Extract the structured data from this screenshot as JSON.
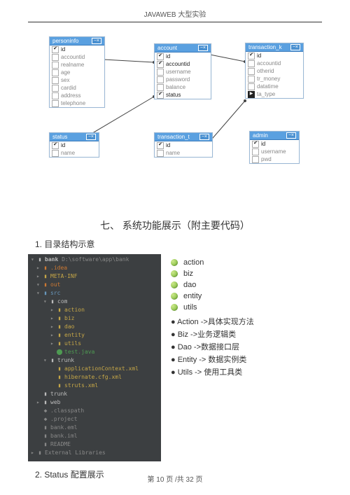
{
  "header": "JAVAWEB 大型实验",
  "er": {
    "tables": {
      "personinfo": {
        "title": "personinfo",
        "fields": [
          {
            "name": "id",
            "checked": true
          },
          {
            "name": "accountid"
          },
          {
            "name": "realname"
          },
          {
            "name": "age"
          },
          {
            "name": "sex"
          },
          {
            "name": "cardid"
          },
          {
            "name": "address"
          },
          {
            "name": "telephone"
          }
        ]
      },
      "status": {
        "title": "status",
        "fields": [
          {
            "name": "id",
            "checked": true
          },
          {
            "name": "name"
          }
        ]
      },
      "account": {
        "title": "account",
        "fields": [
          {
            "name": "id",
            "checked": true
          },
          {
            "name": "accountid",
            "checked": true
          },
          {
            "name": "username"
          },
          {
            "name": "password"
          },
          {
            "name": "balance"
          },
          {
            "name": "status",
            "checked": true
          }
        ]
      },
      "transaction_t": {
        "title": "transaction_t",
        "fields": [
          {
            "name": "id",
            "checked": true
          },
          {
            "name": "name"
          }
        ]
      },
      "transaction_k": {
        "title": "transaction_k",
        "fields": [
          {
            "name": "id",
            "checked": true
          },
          {
            "name": "accountid"
          },
          {
            "name": "otherid"
          },
          {
            "name": "tr_money"
          },
          {
            "name": "datatime"
          },
          {
            "name": "ta_type",
            "dark": true
          }
        ]
      },
      "admin": {
        "title": "admin",
        "fields": [
          {
            "name": "id",
            "checked": true
          },
          {
            "name": "username"
          },
          {
            "name": "pwd"
          }
        ]
      }
    }
  },
  "section7": "七、  系统功能展示（附主要代码）",
  "subsection1": "1. 目录结构示意",
  "tree": {
    "root": "bank",
    "rootpath": "D:\\software\\app\\bank"
  },
  "tree_nodes": [
    {
      "cls": "ind1 orange",
      "arrow": "▸",
      "icon": "▮",
      "text": ".idea"
    },
    {
      "cls": "ind1 yellow",
      "arrow": "▸",
      "icon": "▮",
      "text": "META-INF"
    },
    {
      "cls": "ind1 orange",
      "arrow": "▾",
      "icon": "▮",
      "text": "out"
    },
    {
      "cls": "ind1 blue",
      "arrow": "▾",
      "icon": "▮",
      "text": "src"
    },
    {
      "cls": "ind2",
      "arrow": "▾",
      "icon": "▮",
      "text": "com"
    },
    {
      "cls": "ind3 yellow",
      "arrow": "▸",
      "icon": "▮",
      "text": "action"
    },
    {
      "cls": "ind3 yellow",
      "arrow": "▸",
      "icon": "▮",
      "text": "biz"
    },
    {
      "cls": "ind3 yellow",
      "arrow": "▸",
      "icon": "▮",
      "text": "dao"
    },
    {
      "cls": "ind3 yellow",
      "arrow": "▸",
      "icon": "▮",
      "text": "entity"
    },
    {
      "cls": "ind3 yellow",
      "arrow": "▸",
      "icon": "▮",
      "text": "utils"
    },
    {
      "cls": "ind3 green",
      "arrow": " ",
      "icon": "⬤",
      "text": "test.java"
    },
    {
      "cls": "ind2",
      "arrow": "▾",
      "icon": "▮",
      "text": "trunk"
    },
    {
      "cls": "ind3 yellow",
      "arrow": " ",
      "icon": "▮",
      "text": "applicationContext.xml"
    },
    {
      "cls": "ind3 yellow",
      "arrow": " ",
      "icon": "▮",
      "text": "hibernate.cfg.xml"
    },
    {
      "cls": "ind3 yellow",
      "arrow": " ",
      "icon": "▮",
      "text": "struts.xml"
    },
    {
      "cls": "ind1",
      "arrow": " ",
      "icon": "▮",
      "text": "trunk"
    },
    {
      "cls": "ind1",
      "arrow": "▸",
      "icon": "▮",
      "text": "web"
    },
    {
      "cls": "ind1 gray",
      "arrow": " ",
      "icon": "◆",
      "text": ".classpath"
    },
    {
      "cls": "ind1 gray",
      "arrow": " ",
      "icon": "◆",
      "text": ".project"
    },
    {
      "cls": "ind1 gray",
      "arrow": " ",
      "icon": "▮",
      "text": "bank.eml"
    },
    {
      "cls": "ind1 gray",
      "arrow": " ",
      "icon": "▮",
      "text": "bank.iml"
    },
    {
      "cls": "ind1 gray",
      "arrow": " ",
      "icon": "▮",
      "text": "README"
    }
  ],
  "tree_footer": "External Libraries",
  "packages": [
    "action",
    "biz",
    "dao",
    "entity",
    "utils"
  ],
  "bullets": [
    "Action ->具体实现方法",
    "Biz ->业务逻辑类",
    "Dao ->数据接口层",
    "Entity -> 数据实例类",
    "Utils -> 使用工具类"
  ],
  "subsection2": "2. Status 配置展示",
  "footer": "第 10 页 /共 32 页"
}
